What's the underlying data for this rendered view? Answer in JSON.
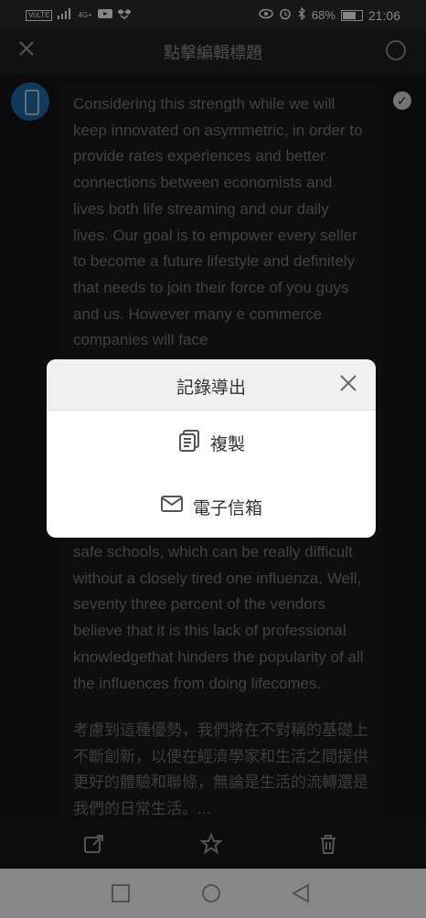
{
  "statusbar": {
    "time": "21:06",
    "battery_text": "68%",
    "battery_level": 0.68,
    "left_badge": "VoLTE",
    "network": "4G+",
    "icons": [
      "signal-icon",
      "video-icon",
      "dropbox-icon",
      "eye-icon",
      "alarm-icon",
      "bluetooth-icon",
      "battery-icon"
    ]
  },
  "topbar": {
    "title": "點擊編輯標題",
    "close_icon": "close-icon",
    "right_icon": "circle-icon"
  },
  "message": {
    "english_top": "Considering this strength while we will keep innovated on asymmetric, in order to provide rates experiences and better connections between economists and lives both life streaming and our daily lives. Our goal is to empower every seller to become a future lifestyle and definitely that needs to join their force of you guys and us. However many e commerce companies will face",
    "english_bottom": "safe schools, which can be really difficult without a closely tired one influenza. Well, seventy three percent of the vendors believe that it is this lack of professional knowledgethat hinders the popularity of all the influences from doing lifecomes.",
    "chinese": "考慮到這種優勢，我們將在不對稱的基礎上不斷創新，以便在經濟學家和生活之間提供更好的體驗和聯條，無論是生活的流轉還是我們的日常生活。..."
  },
  "dialog": {
    "title": "記錄導出",
    "items": [
      {
        "label": "複製",
        "icon": "copy-icon"
      },
      {
        "label": "電子信箱",
        "icon": "mail-icon"
      }
    ]
  },
  "toolbar_icons": [
    "share-icon",
    "star-icon",
    "trash-icon"
  ],
  "navbar_icons": [
    "recent-apps-icon",
    "home-icon",
    "back-icon"
  ],
  "colors": {
    "background": "#141414",
    "avatar_blue": "#1e6aa8",
    "dialog_header": "#f0f0f0"
  }
}
